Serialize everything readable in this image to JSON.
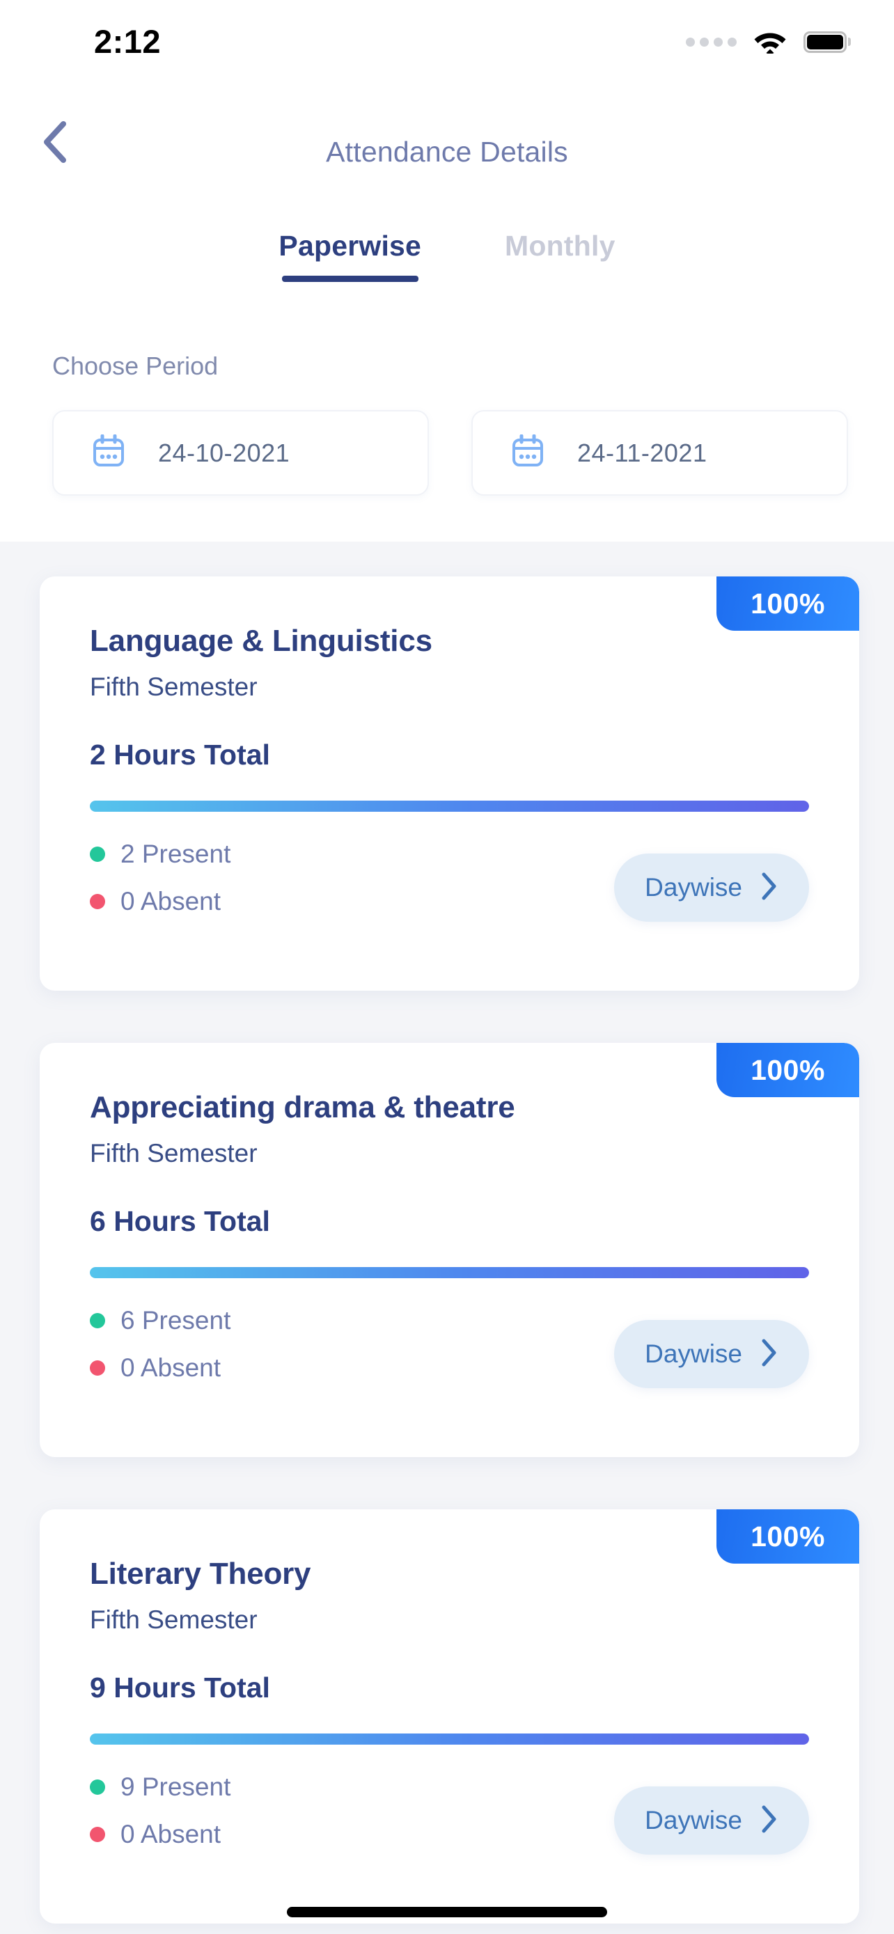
{
  "status_bar": {
    "time": "2:12",
    "signal_icon": "signal-dots-icon",
    "wifi_icon": "wifi-icon",
    "battery_icon": "battery-full-icon"
  },
  "header": {
    "back_icon": "chevron-left-icon",
    "title": "Attendance Details"
  },
  "tabs": [
    {
      "label": "Paperwise",
      "active": true
    },
    {
      "label": "Monthly",
      "active": false
    }
  ],
  "period": {
    "label": "Choose Period",
    "from": {
      "value": "24-10-2021",
      "icon": "calendar-icon"
    },
    "to": {
      "value": "24-11-2021",
      "icon": "calendar-icon"
    }
  },
  "colors": {
    "accent_blue": "#2d3f7f",
    "badge_blue": "#2f8cff",
    "present_green": "#23c79a",
    "absent_red": "#f2556f",
    "page_bg": "#f4f5f8",
    "progress_start": "#55c4ec",
    "progress_end": "#6063e8"
  },
  "cards": [
    {
      "badge": "100%",
      "title": "Language & Linguistics",
      "semester": "Fifth Semester",
      "hours": "2 Hours Total",
      "progress_percent": 100,
      "present": "2 Present",
      "absent": "0 Absent",
      "action_label": "Daywise",
      "action_icon": "chevron-right-icon"
    },
    {
      "badge": "100%",
      "title": "Appreciating drama & theatre",
      "semester": "Fifth Semester",
      "hours": "6 Hours Total",
      "progress_percent": 100,
      "present": "6 Present",
      "absent": "0 Absent",
      "action_label": "Daywise",
      "action_icon": "chevron-right-icon"
    },
    {
      "badge": "100%",
      "title": "Literary Theory",
      "semester": "Fifth Semester",
      "hours": "9 Hours Total",
      "progress_percent": 100,
      "present": "9 Present",
      "absent": "0 Absent",
      "action_label": "Daywise",
      "action_icon": "chevron-right-icon"
    }
  ]
}
